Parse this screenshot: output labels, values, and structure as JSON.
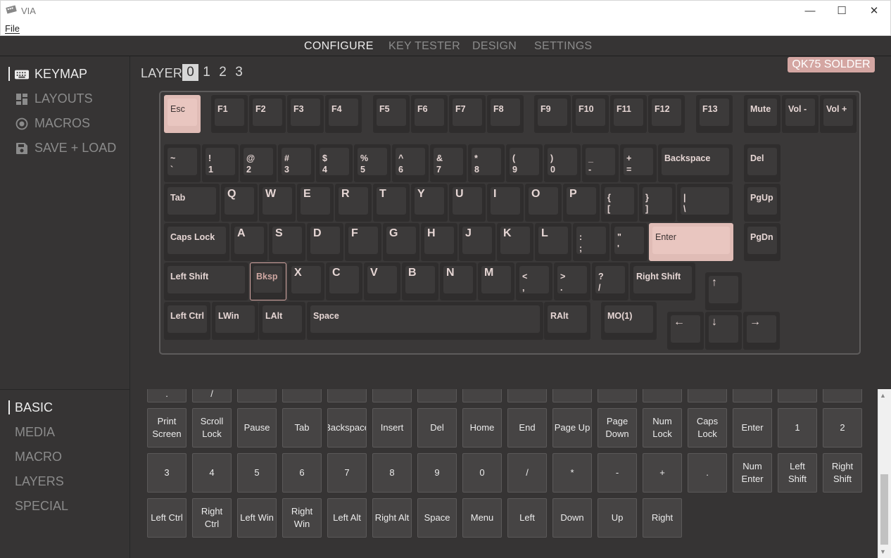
{
  "window": {
    "title": "VIA",
    "minimize": "—",
    "maximize": "☐",
    "close": "✕"
  },
  "menu": {
    "file": "File"
  },
  "nav": {
    "tabs": [
      "CONFIGURE",
      "KEY TESTER",
      "DESIGN",
      "SETTINGS"
    ],
    "active": "CONFIGURE"
  },
  "sidebar": {
    "items": [
      {
        "label": "KEYMAP",
        "icon": "keyboard-icon",
        "active": true
      },
      {
        "label": "LAYOUTS",
        "icon": "layouts-icon",
        "active": false
      },
      {
        "label": "MACROS",
        "icon": "record-circle-icon",
        "active": false
      },
      {
        "label": "SAVE + LOAD",
        "icon": "floppy-disk-icon",
        "active": false
      }
    ]
  },
  "layer": {
    "label": "LAYER",
    "numbers": [
      "0",
      "1",
      "2",
      "3"
    ],
    "active": "0"
  },
  "device": {
    "name": "QK75 SOLDER"
  },
  "keyboard": {
    "keys": [
      {
        "text": "Esc",
        "state": "highlighted"
      },
      {
        "text": "F1"
      },
      {
        "text": "F2"
      },
      {
        "text": "F3"
      },
      {
        "text": "F4"
      },
      {
        "text": "F5"
      },
      {
        "text": "F6"
      },
      {
        "text": "F7"
      },
      {
        "text": "F8"
      },
      {
        "text": "F9"
      },
      {
        "text": "F10"
      },
      {
        "text": "F11"
      },
      {
        "text": "F12"
      },
      {
        "text": "F13"
      },
      {
        "text": "Mute"
      },
      {
        "text": "Vol -"
      },
      {
        "text": "Vol +"
      },
      {
        "text": "~\n`"
      },
      {
        "text": "!\n1"
      },
      {
        "text": "@\n2"
      },
      {
        "text": "#\n3"
      },
      {
        "text": "$\n4"
      },
      {
        "text": "%\n5"
      },
      {
        "text": "^\n6"
      },
      {
        "text": "&\n7"
      },
      {
        "text": "*\n8"
      },
      {
        "text": "(\n9"
      },
      {
        "text": ")\n0"
      },
      {
        "text": "_\n-"
      },
      {
        "text": "+\n="
      },
      {
        "text": "Backspace"
      },
      {
        "text": "Del"
      },
      {
        "text": "Tab"
      },
      {
        "text": "Q"
      },
      {
        "text": "W"
      },
      {
        "text": "E"
      },
      {
        "text": "R"
      },
      {
        "text": "T"
      },
      {
        "text": "Y"
      },
      {
        "text": "U"
      },
      {
        "text": "I"
      },
      {
        "text": "O"
      },
      {
        "text": "P"
      },
      {
        "text": "{\n["
      },
      {
        "text": "}\n]"
      },
      {
        "text": "|\n\\"
      },
      {
        "text": "PgUp"
      },
      {
        "text": "Caps Lock"
      },
      {
        "text": "A"
      },
      {
        "text": "S"
      },
      {
        "text": "D"
      },
      {
        "text": "F"
      },
      {
        "text": "G"
      },
      {
        "text": "H"
      },
      {
        "text": "J"
      },
      {
        "text": "K"
      },
      {
        "text": "L"
      },
      {
        "text": ":\n;"
      },
      {
        "text": "\"\n'"
      },
      {
        "text": "Enter",
        "state": "highlighted"
      },
      {
        "text": "PgDn"
      },
      {
        "text": "Left Shift"
      },
      {
        "text": "Bksp",
        "state": "selected"
      },
      {
        "text": "X"
      },
      {
        "text": "C"
      },
      {
        "text": "V"
      },
      {
        "text": "B"
      },
      {
        "text": "N"
      },
      {
        "text": "M"
      },
      {
        "text": "<\n,"
      },
      {
        "text": ">\n."
      },
      {
        "text": "?\n/"
      },
      {
        "text": "Right Shift"
      },
      {
        "text": "↑"
      },
      {
        "text": "Left Ctrl"
      },
      {
        "text": "LWin"
      },
      {
        "text": "LAlt"
      },
      {
        "text": "Space"
      },
      {
        "text": "RAlt"
      },
      {
        "text": "MO(1)"
      },
      {
        "text": "←"
      },
      {
        "text": "↓"
      },
      {
        "text": "→"
      }
    ]
  },
  "categories": {
    "items": [
      "BASIC",
      "MEDIA",
      "MACRO",
      "LAYERS",
      "SPECIAL"
    ],
    "active": "BASIC"
  },
  "keycodes": {
    "partial_row": [
      ".",
      "/",
      "",
      "",
      "",
      "",
      "",
      "",
      "",
      "",
      "",
      "",
      "",
      "",
      "",
      ""
    ],
    "rows": [
      [
        "Print\nScreen",
        "Scroll\nLock",
        "Pause",
        "Tab",
        "Backspace",
        "Insert",
        "Del",
        "Home",
        "End",
        "Page Up",
        "Page\nDown",
        "Num\nLock",
        "Caps\nLock",
        "Enter",
        "1",
        "2"
      ],
      [
        "3",
        "4",
        "5",
        "6",
        "7",
        "8",
        "9",
        "0",
        "/",
        "*",
        "-",
        "+",
        ".",
        "Num\nEnter",
        "Left\nShift",
        "Right\nShift"
      ],
      [
        "Left Ctrl",
        "Right\nCtrl",
        "Left Win",
        "Right\nWin",
        "Left Alt",
        "Right Alt",
        "Space",
        "Menu",
        "Left",
        "Down",
        "Up",
        "Right"
      ]
    ]
  },
  "scrollbar": {
    "up": "▲",
    "down": "▼",
    "position": 0.78
  },
  "colors": {
    "background": "#363434",
    "accent": "#d4a6a2",
    "key": "#3c3a3a",
    "highlight_key": "#e9c6c0"
  }
}
